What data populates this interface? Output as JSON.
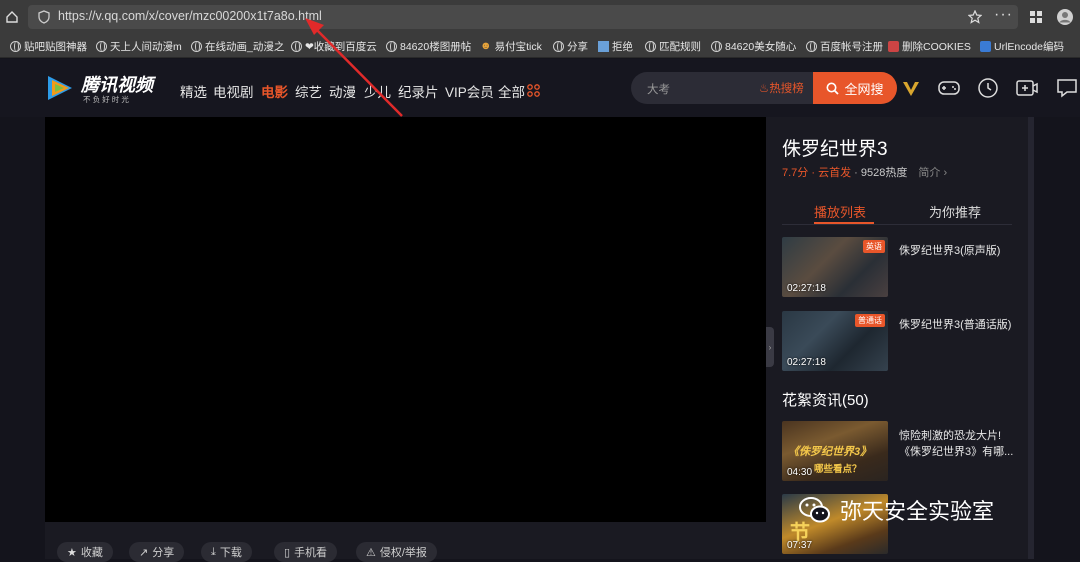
{
  "browser": {
    "url": "https://v.qq.com/x/cover/mzc00200x1t7a8o.html",
    "bookmarks": [
      "贴吧贴图神器",
      "天上人间动漫m",
      "在线动画_动漫之",
      "❤收藏到百度云",
      "84620楼图册帖",
      "易付宝tick",
      "分享",
      "拒绝",
      "匹配规则",
      "84620美女随心",
      "百度帐号注册",
      "删除COOKIES",
      "UrlEncode编码"
    ]
  },
  "site": {
    "logo_name": "腾讯视频",
    "logo_slogan": "不 负 好 时 光",
    "nav": [
      "精选",
      "电视剧",
      "电影",
      "综艺",
      "动漫",
      "少儿",
      "纪录片",
      "VIP会员",
      "全部"
    ],
    "search_placeholder": "大考",
    "hot_label": "热搜榜",
    "search_button": "全网搜"
  },
  "player_actions": [
    "收藏",
    "分享",
    "下载",
    "手机看",
    "侵权/举报"
  ],
  "sidebar": {
    "title": "侏罗纪世界3",
    "score": "7.7分",
    "release": "云首发",
    "heat": "9528热度",
    "intro": "简介",
    "tabs": [
      "播放列表",
      "为你推荐"
    ],
    "episodes": [
      {
        "title": "侏罗纪世界3(原声版)",
        "duration": "02:27:18",
        "badge": "英语"
      },
      {
        "title": "侏罗纪世界3(普通话版)",
        "duration": "02:27:18",
        "badge": "普通话"
      }
    ],
    "section_title": "花絮资讯(50)",
    "clips": [
      {
        "title_line1": "惊险刺激的恐龙大片!",
        "title_line2": "《侏罗纪世界3》有哪...",
        "duration": "04:30",
        "overlay": "《侏罗纪世界3》",
        "overlay2": "哪些看点？"
      },
      {
        "title_line1": "",
        "title_line2": "",
        "duration": "07:37",
        "overlay": "节",
        "overlay2": ""
      }
    ]
  },
  "watermark": "弥天安全实验室",
  "colors": {
    "accent": "#e8562a",
    "vip_gold": "#d9a62e"
  }
}
